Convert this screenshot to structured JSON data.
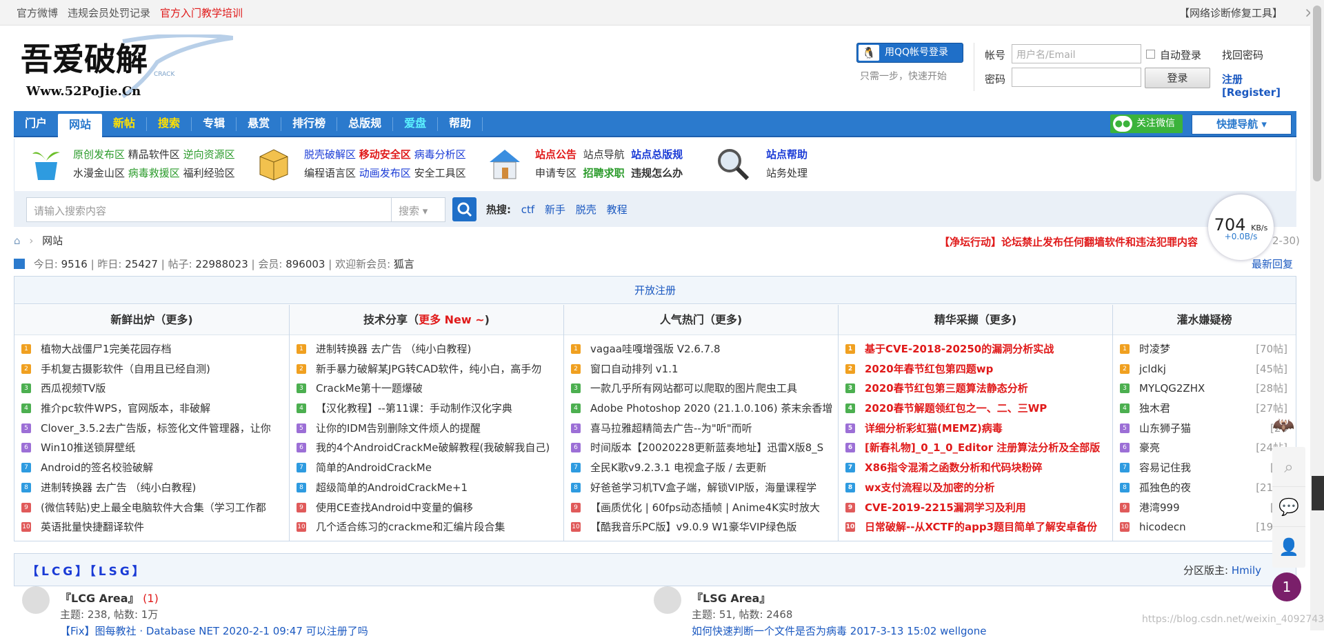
{
  "topbar": {
    "weibo": "官方微博",
    "penalty": "违规会员处罚记录",
    "training": "官方入门教学培训",
    "diag": "【网络诊断修复工具】",
    "close": "⨯"
  },
  "logo": {
    "line1": "吾爱破解",
    "line2": "Www.52PoJie.Cn",
    "crack": "CRACK"
  },
  "login": {
    "qq_btn": "用QQ帐号登录",
    "qq_hint": "只需一步，快速开始",
    "account_label": "帐号",
    "account_placeholder": "用户名/Email",
    "auto_login": "自动登录",
    "find_pwd": "找回密码",
    "password_label": "密码",
    "login_btn": "登录",
    "register": "注册[Register]"
  },
  "nav": {
    "items": [
      "门户",
      "网站",
      "新帖",
      "搜索",
      "专辑",
      "悬赏",
      "排行榜",
      "总版规",
      "爱盘",
      "帮助"
    ],
    "wechat": "关注微信",
    "quick": "快捷导航 ▾"
  },
  "subnav": {
    "g1": {
      "r1": [
        "原创发布区",
        "精品软件区",
        "逆向资源区"
      ],
      "r2": [
        "水漫金山区",
        "病毒救援区",
        "福利经验区"
      ]
    },
    "g2": {
      "r1": [
        "脱壳破解区",
        "移动安全区",
        "病毒分析区"
      ],
      "r2": [
        "编程语言区",
        "动画发布区",
        "安全工具区"
      ]
    },
    "g3": {
      "r1": [
        "站点公告",
        "站点导航",
        "站点总版规"
      ],
      "r2": [
        "申请专区",
        "招聘求职",
        "违规怎么办"
      ]
    },
    "g4": {
      "r1": [
        "站点帮助"
      ],
      "r2": [
        "站务处理"
      ]
    }
  },
  "search": {
    "placeholder": "请输入搜索内容",
    "select": "搜索 ▾",
    "hot_label": "热搜:",
    "hot": [
      "ctf",
      "新手",
      "脱壳",
      "教程"
    ]
  },
  "speed": {
    "value": "704",
    "unit": "KB/s",
    "up": "+0.0B/s"
  },
  "crumb": {
    "home": "⌂",
    "arrow": "›",
    "current": "网站"
  },
  "notice": {
    "text": "【净坛行动】论坛禁止发布任何翻墙软件和违法犯罪内容",
    "date": "2-30)"
  },
  "stats": {
    "today_label": "今日:",
    "today": "9516",
    "yesterday_label": "昨日:",
    "yesterday": "25427",
    "posts_label": "帖子:",
    "posts": "22988023",
    "members_label": "会员:",
    "members": "896003",
    "welcome_label": "欢迎新会员:",
    "newest": "狐言",
    "latest": "最新回复"
  },
  "panel": {
    "open_reg": "开放注册"
  },
  "columns": [
    {
      "title": "新鲜出炉（更多)",
      "items": [
        "植物大战僵尸1完美花园存档",
        "手机复古摄影软件（自用且已经自测)",
        "西瓜视频TV版",
        "推介pc软件WPS，官网版本，非破解",
        "Clover_3.5.2去广告版，标签化文件管理器，让你",
        "Win10推送锁屏壁纸",
        "Android的签名校验破解",
        "进制转换器 去广告 （纯小白教程)",
        "(微信转贴)史上最全电脑软件大合集（学习工作都",
        "英语批量快捷翻译软件"
      ]
    },
    {
      "title": "技术分享（",
      "title_red": "更多 New ~",
      "title_end": ")",
      "items": [
        "进制转换器 去广告 （纯小白教程)",
        "新手暴力破解某JPG转CAD软件，纯小白，高手勿",
        "CrackMe第十一题爆破",
        "【汉化教程】--第11课：手动制作汉化字典",
        "让你的IDM告别删除文件烦人的提醒",
        "我的4个AndroidCrackMe破解教程(我破解我自己)",
        "简单的AndroidCrackMe",
        "超级简单的AndroidCrackMe+1",
        "使用CE查找Android中变量的偏移",
        "几个适合练习的crackme和汇编片段合集"
      ]
    },
    {
      "title": "人气热门（更多)",
      "items": [
        "vagaa哇嘎增强版 V2.6.7.8",
        "窗口自动排列 v1.1",
        "一款几乎所有网站都可以爬取的图片爬虫工具",
        "Adobe Photoshop 2020 (21.1.0.106) 茶末余香增",
        "喜马拉雅超精简去广告--为\"听\"而听",
        "时间版本【20020228更新蓝奏地址】迅雷X版8_S",
        "全民K歌v9.2.3.1 电视盒子版 / 去更新",
        "好爸爸学习机TV盒子端，解锁VIP版，海量课程学",
        "【画质优化 | 60fps动态插帧 | Anime4K实时放大",
        "【酷我音乐PC版】v9.0.9 W1豪华VIP绿色版"
      ]
    },
    {
      "title": "精华采撷（更多)",
      "items": [
        "基于CVE-2018-20250的漏洞分析实战",
        "2020年春节红包第四题wp",
        "2020春节红包第三题算法静态分析",
        "2020春节解题领红包之一、二、三WP",
        "详细分析彩虹猫(MEMZ)病毒",
        "[新春礼物]_0_1_0_Editor 注册算法分析及全部版",
        "X86指令混淆之函数分析和代码块粉碎",
        "wx支付流程以及加密的分析",
        "CVE-2019-2215漏洞学习及利用",
        "日常破解--从XCTF的app3题目简单了解安卓备份"
      ]
    },
    {
      "title": "灌水嫌疑榜",
      "items": [
        "时凌梦",
        "jcldkj",
        "MYLQG2ZHX",
        "独木君",
        "山东狮子猫",
        "豪亮",
        "容易记住我",
        "孤独色的夜",
        "港湾999",
        "hicodecn"
      ],
      "counts": [
        "[70帖]",
        "[45帖]",
        "[28帖]",
        "[27帖]",
        "[26",
        "[24帖]",
        "[22",
        "[21帖]",
        "[20",
        "[19帖]"
      ]
    }
  ],
  "nums": [
    "1",
    "2",
    "3",
    "4",
    "5",
    "6",
    "7",
    "8",
    "9",
    "10"
  ],
  "section": {
    "title": "【LCG】【LSG】",
    "mod_label": "分区版主:",
    "mod": "Hmily"
  },
  "forums": [
    {
      "name": "『LCG Area』",
      "today": "(1)",
      "stats": "主题: 238, 帖数: 1万",
      "last": "【Fix】图每教社 · Database NET  2020-2-1 09:47 可以注册了吗"
    },
    {
      "name": "『LSG Area』",
      "today": "",
      "stats": "主题: 51, 帖数: 2468",
      "last": "如何快速判断一个文件是否为病毒  2017-3-13 15:02 wellgone"
    }
  ],
  "side": {
    "badge": "1",
    "watermark": "https://blog.csdn.net/weixin_40927436"
  },
  "colors": {
    "accent": "#2b7acd",
    "red": "#e01a1a",
    "green": "#2b9b2b"
  }
}
